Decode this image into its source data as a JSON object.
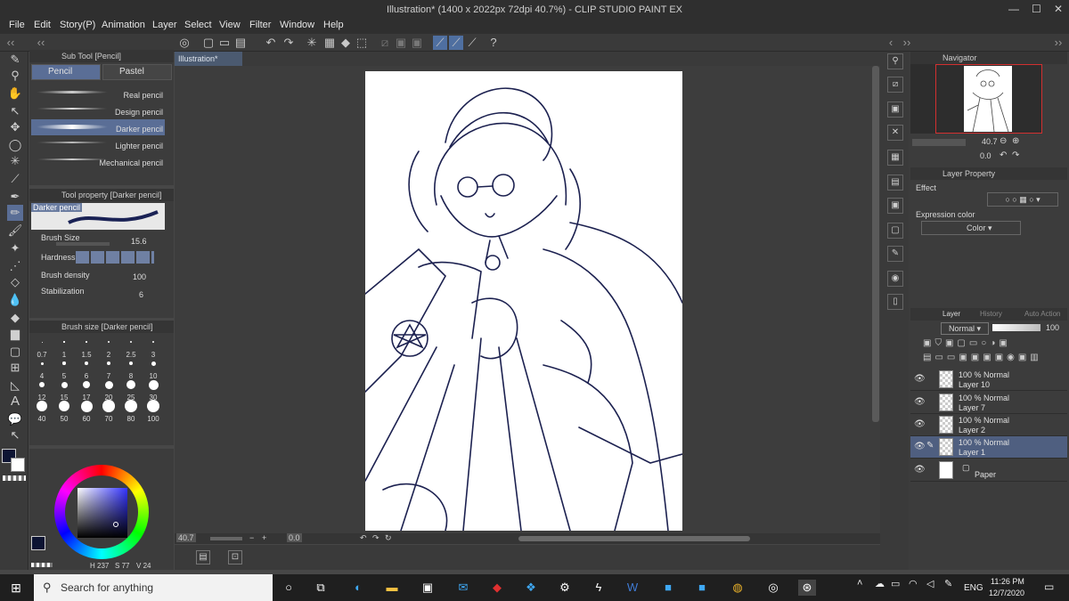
{
  "window": {
    "title": "Illustration* (1400 x 2022px 72dpi 40.7%)  - CLIP STUDIO PAINT EX",
    "min": "—",
    "max": "☐",
    "close": "✕"
  },
  "menu": [
    "File",
    "Edit",
    "Story(P)",
    "Animation",
    "Layer",
    "Select",
    "View",
    "Filter",
    "Window",
    "Help"
  ],
  "subtool": {
    "header": "Sub Tool [Pencil]",
    "tabs": [
      "Pencil",
      "Pastel"
    ],
    "brushes": [
      "Real pencil",
      "Design pencil",
      "Darker pencil",
      "Lighter pencil",
      "Mechanical pencil"
    ],
    "selected": "Darker pencil"
  },
  "tool_property": {
    "header": "Tool property [Darker pencil]",
    "preview_label": "Darker pencil",
    "brush_size_label": "Brush Size",
    "brush_size_value": "15.6",
    "hardness_label": "Hardness",
    "density_label": "Brush density",
    "density_value": "100",
    "stabilization_label": "Stabilization",
    "stabilization_value": "6"
  },
  "brush_size": {
    "header": "Brush size [Darker pencil]",
    "sizes": [
      "0.7",
      "1",
      "1.5",
      "2",
      "2.5",
      "3",
      "4",
      "5",
      "6",
      "7",
      "8",
      "10",
      "12",
      "15",
      "17",
      "20",
      "25",
      "30",
      "40",
      "50",
      "60",
      "70",
      "80",
      "100"
    ]
  },
  "color": {
    "main": "#0d1433",
    "readout": [
      "237",
      "77",
      "24"
    ],
    "readout_icons": [
      "H",
      "S",
      "V"
    ]
  },
  "canvas": {
    "tab_label": "Illustration*",
    "zoom": "40.7",
    "angle": "0.0"
  },
  "navigator": {
    "header": "Navigator",
    "zoom": "40.7",
    "angle": "0.0"
  },
  "layer_property": {
    "header": "Layer Property",
    "effect_label": "Effect",
    "expression_label": "Expression color",
    "expression_value": "Color"
  },
  "layers_panel": {
    "tabs": [
      "Layer",
      "History",
      "Auto Action"
    ],
    "blend_mode": "Normal",
    "opacity": "100",
    "layers": [
      {
        "mode": "100 % Normal",
        "name": "Layer 10"
      },
      {
        "mode": "100 % Normal",
        "name": "Layer 7"
      },
      {
        "mode": "100 % Normal",
        "name": "Layer 2"
      },
      {
        "mode": "100 % Normal",
        "name": "Layer 1"
      }
    ],
    "paper": "Paper"
  },
  "taskbar": {
    "search_placeholder": "Search for anything",
    "language": "ENG",
    "time": "11:26 PM",
    "date": "12/7/2020"
  },
  "colors": {
    "accent": "#5a6e96",
    "selected_row": "#4f5f80"
  }
}
